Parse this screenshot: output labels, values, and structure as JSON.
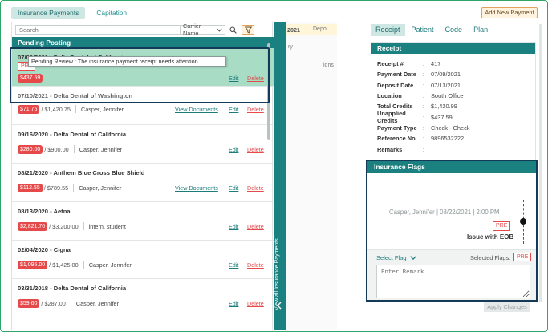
{
  "tabs": [
    "Insurance Payments",
    "Capitation"
  ],
  "add_button": "Add New Payment",
  "search": {
    "placeholder": "Search",
    "carrier_select": "Carrier Name"
  },
  "pending_header": "Pending Posting",
  "items": [
    {
      "title": "07/09/2021 - Delta Dental of California",
      "amount": "$437.59",
      "total": "",
      "provider": "",
      "links": {
        "edit": "Edit",
        "delete": "Delete"
      }
    },
    {
      "title": "07/10/2021 - Delta Dental of Washington",
      "amount": "$71.75",
      "total": "/ $1,420.75",
      "provider": "Casper, Jennifer",
      "links": {
        "view": "View Documents",
        "edit": "Edit",
        "delete": "Delete"
      }
    },
    {
      "title": "09/16/2020 - Delta Dental of California",
      "amount": "$280.00",
      "total": "/ $900.00",
      "provider": "Casper, Jennifer",
      "links": {
        "edit": "Edit",
        "delete": "Delete"
      }
    },
    {
      "title": "08/21/2020 - Anthem Blue Cross Blue Shield",
      "amount": "$112.55",
      "total": "/ $789.55",
      "provider": "Casper, Jennifer",
      "links": {
        "view": "View Documents",
        "edit": "Edit",
        "delete": "Delete"
      }
    },
    {
      "title": "08/13/2020 - Aetna",
      "amount": "$2,821.70",
      "total": "/ $3,200.00",
      "provider": "intern, student",
      "links": {
        "edit": "Edit",
        "delete": "Delete"
      }
    },
    {
      "title": "02/04/2020 - Cigna",
      "amount": "$1,095.00",
      "total": "/ $1,425.00",
      "provider": "Casper, Jennifer",
      "links": {
        "edit": "Edit",
        "delete": "Delete"
      }
    },
    {
      "title": "03/31/2018 - Delta Dental of California",
      "amount": "$59.60",
      "total": "/ $287.00",
      "provider": "Casper, Jennifer",
      "links": {
        "edit": "Edit",
        "delete": "Delete"
      }
    }
  ],
  "pre_badge": "PRE",
  "tooltip": "Pending Review : The insurance payment receipt needs attention.",
  "vertical_bar": "View all Insurance Payments",
  "background_table": {
    "date": "2021",
    "dep": "Depo",
    "frag1": "ry",
    "frag2": "ions"
  },
  "right_tabs": [
    "Receipt",
    "Patient",
    "Code",
    "Plan"
  ],
  "receipt": {
    "header": "Receipt",
    "rows": [
      {
        "label": "Receipt #",
        "value": "417"
      },
      {
        "label": "Payment Date",
        "value": "07/09/2021"
      },
      {
        "label": "Deposit Date",
        "value": "07/13/2021"
      },
      {
        "label": "Location",
        "value": "South Office"
      },
      {
        "label": "Total Credits",
        "value": "$1,420.99"
      },
      {
        "label": "Unapplied Credits",
        "value": "$437.59"
      },
      {
        "label": "Payment Type",
        "value": "Check - Check"
      },
      {
        "label": "Reference No.",
        "value": "9896532222"
      },
      {
        "label": "Remarks",
        "value": ""
      }
    ]
  },
  "flags": {
    "header": "Insurance Flags",
    "entry": {
      "meta": "Casper, Jennifer | 08/22/2021 | 2:00 PM",
      "badge": "PRE",
      "issue": "Issue with EOB"
    },
    "select_flag": "Select Flag",
    "selected_flags": "Selected Flags:",
    "selected_badge": "PRE",
    "remark_placeholder": "Enter Remark"
  },
  "apply_button": "Apply Changes",
  "colors": {
    "teal": "#1b8080",
    "red": "#e5494a",
    "selected_row": "#a8dcc4",
    "highlight_border": "#153a57"
  }
}
